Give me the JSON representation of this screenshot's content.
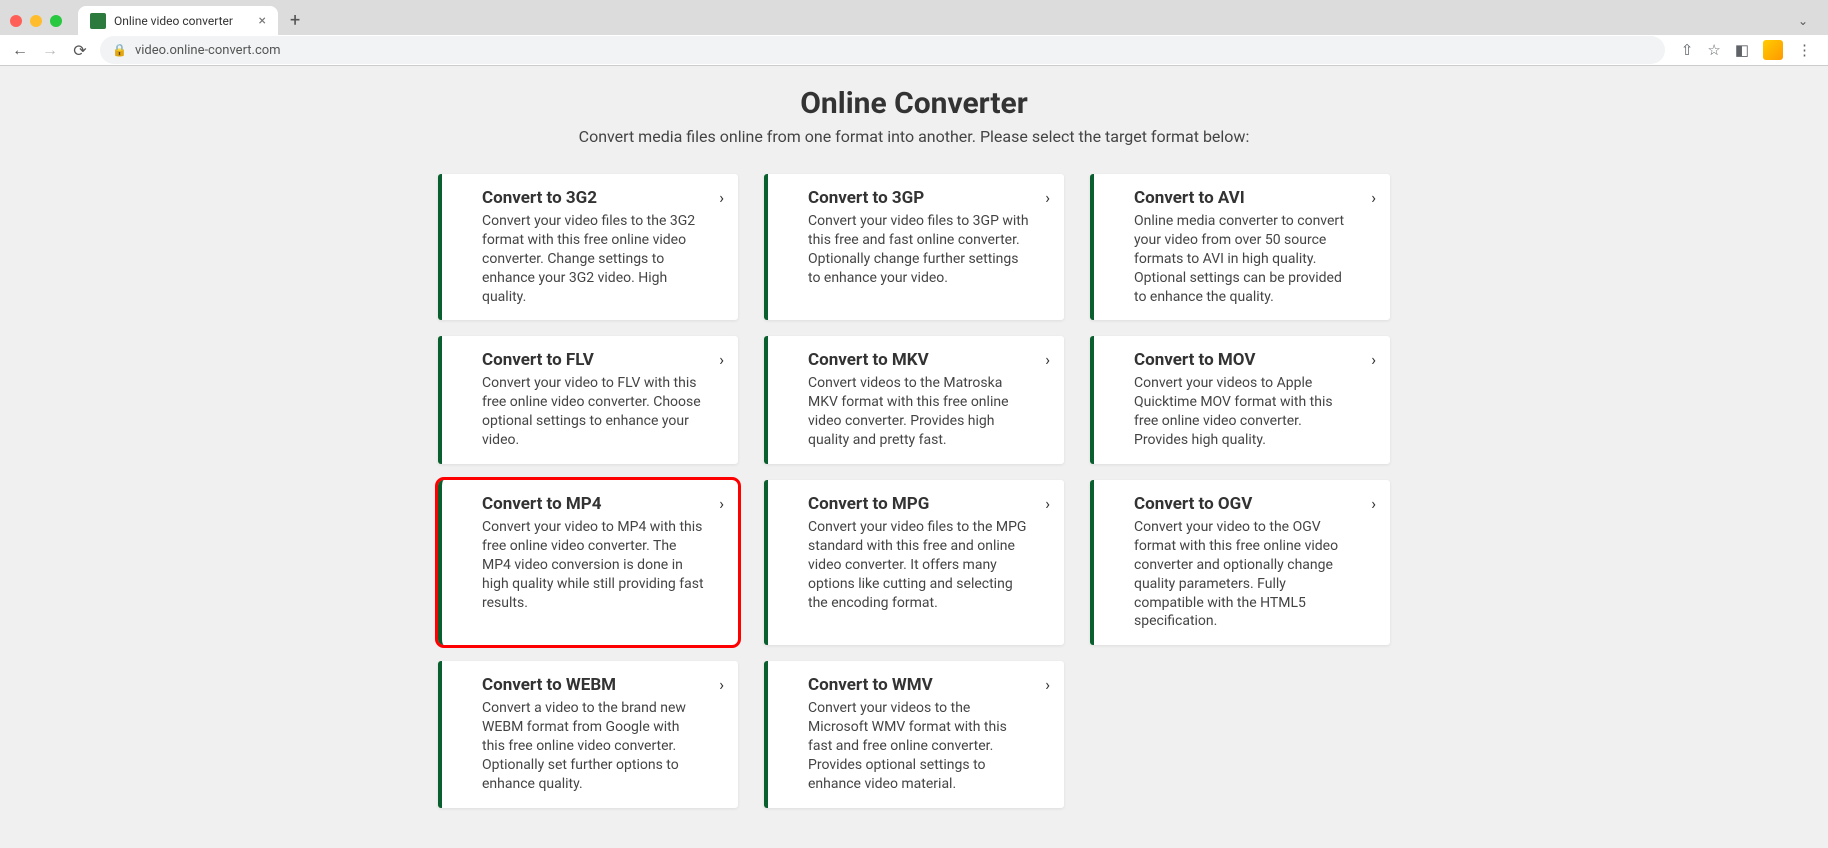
{
  "browser": {
    "tab_title": "Online video converter",
    "url": "video.online-convert.com"
  },
  "page": {
    "title": "Online Converter",
    "subtitle": "Convert media files online from one format into another. Please select the target format below:"
  },
  "cards": [
    {
      "id": "3g2",
      "title": "Convert to 3G2",
      "desc": "Convert your video files to the 3G2 format with this free online video converter. Change settings to enhance your 3G2 video. High quality.",
      "highlight": false
    },
    {
      "id": "3gp",
      "title": "Convert to 3GP",
      "desc": "Convert your video files to 3GP with this free and fast online converter. Optionally change further settings to enhance your video.",
      "highlight": false
    },
    {
      "id": "avi",
      "title": "Convert to AVI",
      "desc": "Online media converter to convert your video from over 50 source formats to AVI in high quality. Optional settings can be provided to enhance the quality.",
      "highlight": false
    },
    {
      "id": "flv",
      "title": "Convert to FLV",
      "desc": "Convert your video to FLV with this free online video converter. Choose optional settings to enhance your video.",
      "highlight": false
    },
    {
      "id": "mkv",
      "title": "Convert to MKV",
      "desc": "Convert videos to the Matroska MKV format with this free online video converter. Provides high quality and pretty fast.",
      "highlight": false
    },
    {
      "id": "mov",
      "title": "Convert to MOV",
      "desc": "Convert your videos to Apple Quicktime MOV format with this free online video converter. Provides high quality.",
      "highlight": false
    },
    {
      "id": "mp4",
      "title": "Convert to MP4",
      "desc": "Convert your video to MP4 with this free online video converter. The MP4 video conversion is done in high quality while still providing fast results.",
      "highlight": true
    },
    {
      "id": "mpg",
      "title": "Convert to MPG",
      "desc": "Convert your video files to the MPG standard with this free and online video converter. It offers many options like cutting and selecting the encoding format.",
      "highlight": false
    },
    {
      "id": "ogv",
      "title": "Convert to OGV",
      "desc": "Convert your video to the OGV format with this free online video converter and optionally change quality parameters. Fully compatible with the HTML5 specification.",
      "highlight": false
    },
    {
      "id": "webm",
      "title": "Convert to WEBM",
      "desc": "Convert a video to the brand new WEBM format from Google with this free online video converter. Optionally set further options to enhance quality.",
      "highlight": false
    },
    {
      "id": "wmv",
      "title": "Convert to WMV",
      "desc": "Convert your videos to the Microsoft WMV format with this fast and free online converter. Provides optional settings to enhance video material.",
      "highlight": false
    }
  ]
}
